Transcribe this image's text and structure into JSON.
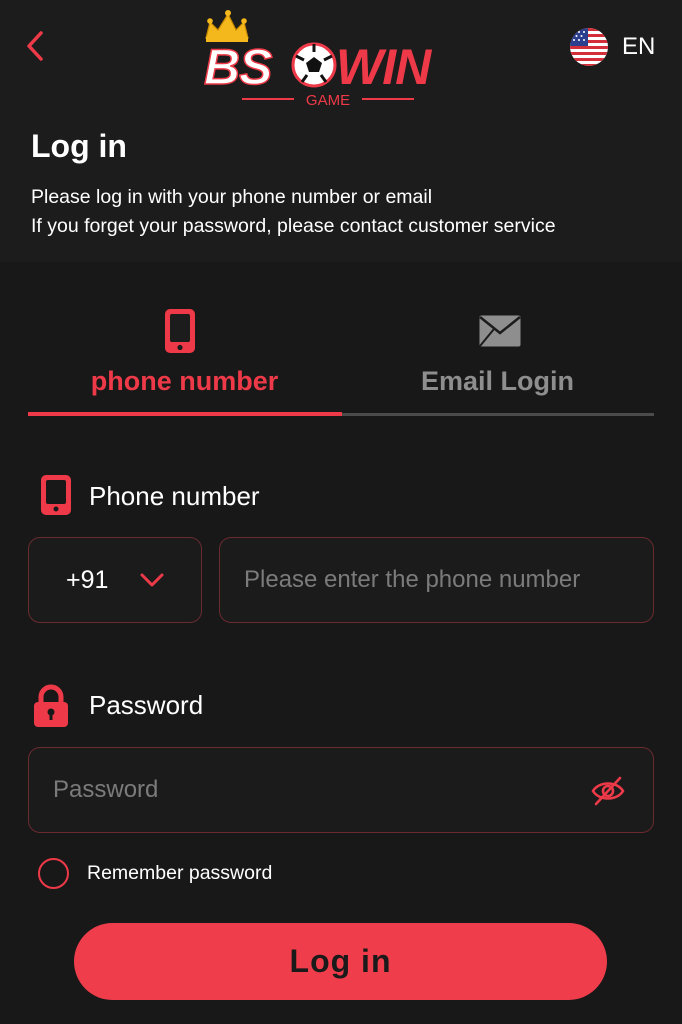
{
  "header": {
    "back_icon": "chevron-left-icon",
    "logo": {
      "brand": "BSWIN",
      "sub": "GAME"
    },
    "language": {
      "code": "EN",
      "flag": "us-flag-icon"
    }
  },
  "intro": {
    "title": "Log in",
    "line1": "Please log in with your phone number or email",
    "line2": "If you forget your password, please contact customer service"
  },
  "tabs": [
    {
      "label": "phone number",
      "icon": "phone-icon",
      "active": true
    },
    {
      "label": "Email Login",
      "icon": "mail-icon",
      "active": false
    }
  ],
  "form": {
    "phone_label": "Phone number",
    "country_code": "+91",
    "phone_placeholder": "Please enter the phone number",
    "password_label": "Password",
    "password_placeholder": "Password",
    "remember_label": "Remember password",
    "submit_label": "Log in"
  },
  "colors": {
    "accent": "#ee3a48",
    "background": "#181818",
    "inactive_text": "#8e8e8e",
    "field_border": "#6a2a30"
  }
}
